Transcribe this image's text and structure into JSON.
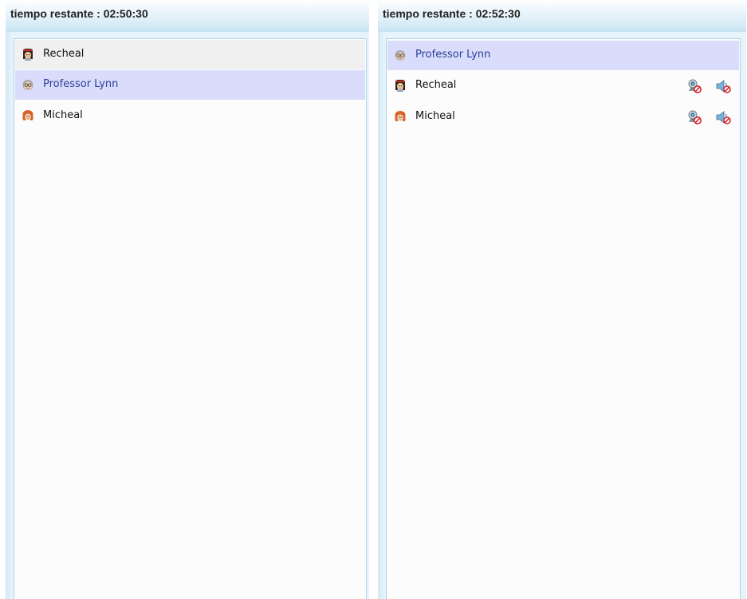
{
  "left_panel": {
    "title": "tiempo restante : 02:50:30",
    "users": [
      {
        "name": "Recheal",
        "avatar": "girl-dark-hair-icon",
        "state": "selected"
      },
      {
        "name": "Professor Lynn",
        "avatar": "professor-glasses-icon",
        "state": "self"
      },
      {
        "name": "Micheal",
        "avatar": "girl-red-hair-icon",
        "state": "normal"
      }
    ]
  },
  "right_panel": {
    "title": "tiempo restante : 02:52:30",
    "users": [
      {
        "name": "Professor Lynn",
        "avatar": "professor-glasses-icon",
        "state": "self"
      },
      {
        "name": "Recheal",
        "avatar": "girl-dark-hair-icon",
        "state": "normal",
        "controls": [
          "webcam-disabled-icon",
          "speaker-muted-icon"
        ]
      },
      {
        "name": "Micheal",
        "avatar": "girl-red-hair-icon",
        "state": "normal",
        "controls": [
          "webcam-disabled-icon",
          "speaker-muted-icon"
        ]
      }
    ]
  },
  "colors": {
    "self_highlight": "#d9dcfb",
    "self_text": "#2b3f97",
    "selected_highlight": "#f0f0f0",
    "panel_border": "#a9d5ea"
  }
}
